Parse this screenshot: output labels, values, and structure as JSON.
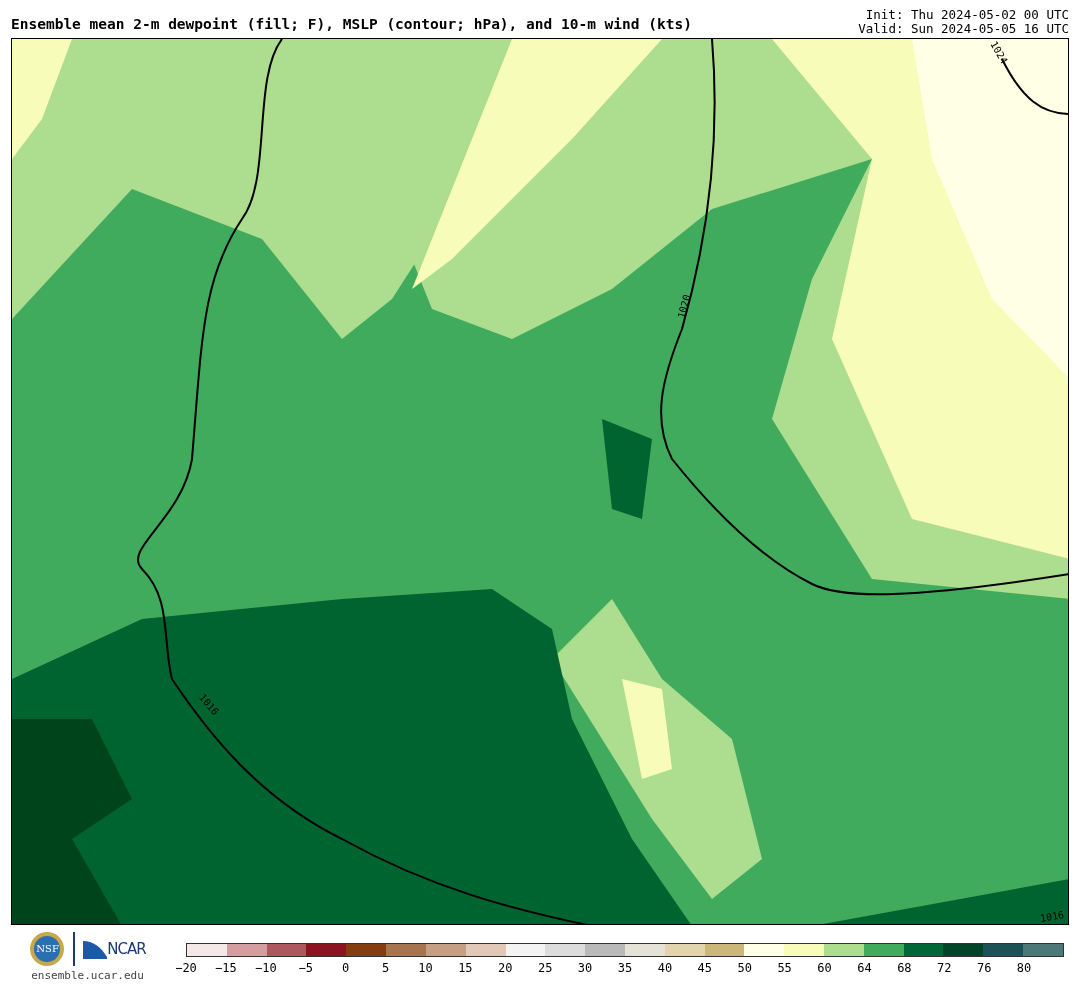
{
  "title": "Ensemble mean 2-m dewpoint (fill; F), MSLP (contour; hPa), and 10-m wind (kts)",
  "init": "Init: Thu 2024-05-02 00 UTC",
  "valid": "Valid: Sun 2024-05-05 16 UTC",
  "map": {
    "contour_labels": [
      "1024",
      "1020",
      "1016",
      "1016"
    ]
  },
  "logos": {
    "nsf": "NSF",
    "ncar": "NCAR",
    "site": "ensemble.ucar.edu"
  },
  "colorbar": {
    "segments": [
      {
        "color": "#f5e8e8"
      },
      {
        "color": "#d49ea1"
      },
      {
        "color": "#ad585c"
      },
      {
        "color": "#8b1420"
      },
      {
        "color": "#833d0e"
      },
      {
        "color": "#a67550"
      },
      {
        "color": "#c69e83"
      },
      {
        "color": "#e2c8b6"
      },
      {
        "color": "#f3f3f3"
      },
      {
        "color": "#dcdcdc"
      },
      {
        "color": "#b9b9b9"
      },
      {
        "color": "#e5e3d7"
      },
      {
        "color": "#e2d5ae"
      },
      {
        "color": "#cbb777"
      },
      {
        "color": "#ffffe5"
      },
      {
        "color": "#f7fcb9"
      },
      {
        "color": "#addd8e"
      },
      {
        "color": "#41ab5d"
      },
      {
        "color": "#006837"
      },
      {
        "color": "#004529"
      },
      {
        "color": "#1b5157"
      },
      {
        "color": "#4c7878"
      }
    ],
    "ticks": [
      "−20",
      "−15",
      "−10",
      "−5",
      "0",
      "5",
      "10",
      "15",
      "20",
      "25",
      "30",
      "35",
      "40",
      "45",
      "50",
      "55",
      "60",
      "64",
      "68",
      "72",
      "76",
      "80"
    ]
  }
}
